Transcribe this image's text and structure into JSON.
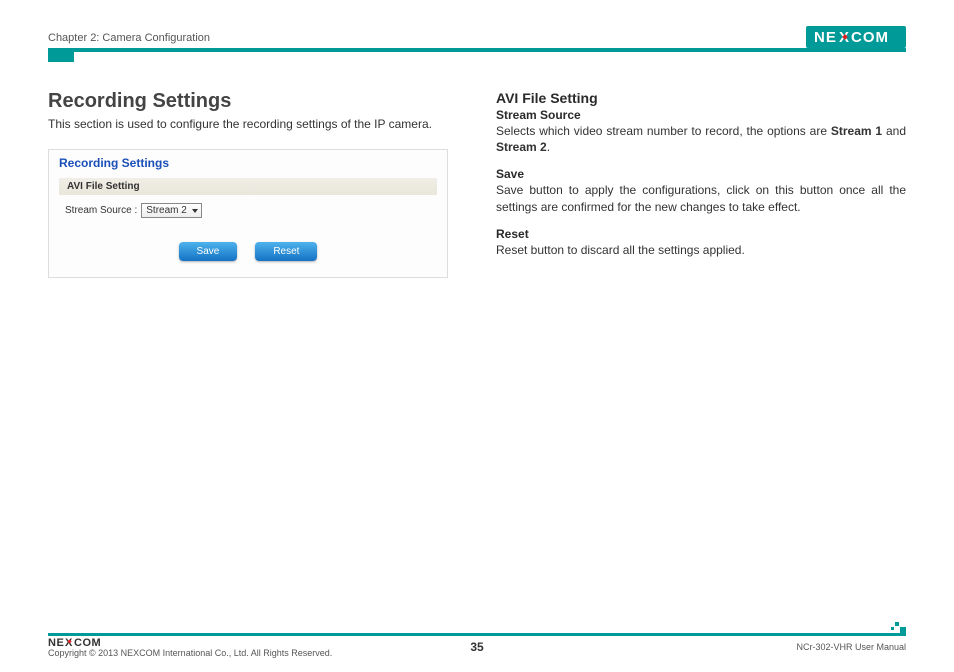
{
  "header": {
    "chapter": "Chapter 2: Camera Configuration",
    "logo_text": "NEXCOM"
  },
  "left": {
    "title": "Recording Settings",
    "intro": "This section is used to configure the recording settings of the IP camera.",
    "panel": {
      "title": "Recording Settings",
      "subtitle": "AVI File Setting",
      "field_label": "Stream Source :",
      "field_value": "Stream 2",
      "save_label": "Save",
      "reset_label": "Reset"
    }
  },
  "right": {
    "h2": "AVI File Setting",
    "sections": [
      {
        "heading": "Stream Source",
        "body_pre": "Selects which video stream number to record, the options are ",
        "b1": "Stream 1",
        "mid": " and ",
        "b2": "Stream 2",
        "post": "."
      },
      {
        "heading": "Save",
        "body": "Save button to apply the configurations, click on this button once all the settings are confirmed for the new changes to take effect."
      },
      {
        "heading": "Reset",
        "body": "Reset button to discard all the settings applied."
      }
    ]
  },
  "footer": {
    "copyright": "Copyright © 2013 NEXCOM International Co., Ltd. All Rights Reserved.",
    "page": "35",
    "doc": "NCr-302-VHR User Manual"
  }
}
